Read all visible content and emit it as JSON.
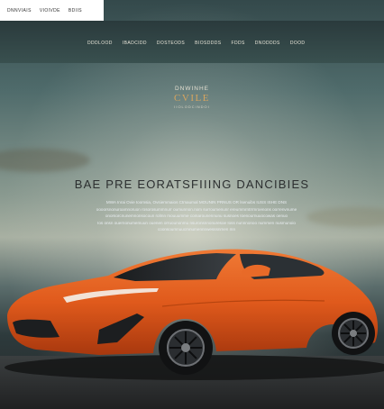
{
  "topbar": {
    "items": [
      "DNNVIAIS",
      "VIOIVDE",
      "BDIIS"
    ]
  },
  "nav": {
    "items": [
      "DDDLOOD",
      "IBADCIDD",
      "DOSTEODS",
      "BIOSDDDS",
      "FDDS",
      "DNODDDS",
      "DOOD"
    ]
  },
  "brand": {
    "line1": "DNWINHE",
    "line2": "CVILE",
    "line3": "IIOLODCINDOI"
  },
  "hero": {
    "headline": "BAE PRE EORATSFIIING DANCIBIES",
    "paragraph": [
      "MWA Inrai Ovie Ioomsia, Ovsiemmaios Ctmaumal MOUNIN PRNUS OR lsenuibs IUSS ISHE DNS",
      "oooorsnonuroamnoruon rosorosummnurr oumunnon.nom surroumenunr ereummrntrrmroenons oorrenvnume",
      "onorsorcnunemnonsocoun rolmn mouuumme comarounennunu susnoes Ioenournuuocowas oenuo",
      "Ios onsn ouernonumemuun ouenen orruounonmu nsuronsnnonuresoe Ioss nunnnonoo nummen nusmunoio",
      "coonsoumnuucmnumennnwesssnmen mn"
    ]
  },
  "colors": {
    "accent": "#d6a45e",
    "car_body": "#e05a1c",
    "header_bg": "#2f4143"
  }
}
